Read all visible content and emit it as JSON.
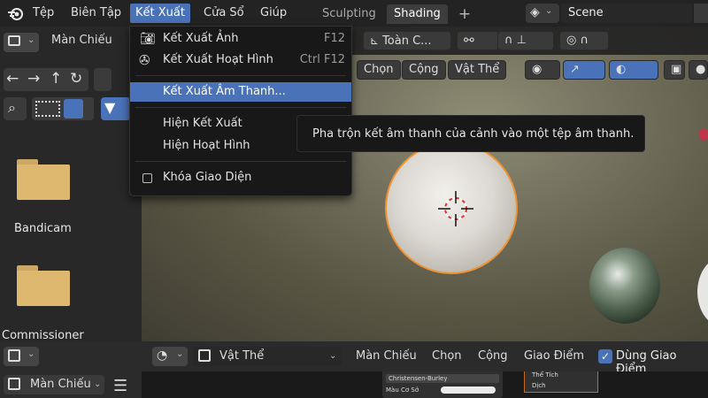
{
  "topbar": {
    "menus": [
      "Tệp",
      "Biên Tập",
      "Kết Xuất",
      "Cửa Sổ",
      "Giúp"
    ],
    "workspace_tabs": [
      "Sculpting",
      "Shading"
    ],
    "add_tab": "+",
    "scene_name": "Scene"
  },
  "file_browser": {
    "view_label": "Màn Chiếu",
    "folders": [
      "Bandicam",
      "Commissioner"
    ]
  },
  "viewport": {
    "transform_orientation": "Toàn C...",
    "header_buttons": [
      "Chọn",
      "Cộng",
      "Vật Thể"
    ]
  },
  "render_menu": {
    "items": [
      {
        "label": "Kết Xuất Ảnh",
        "shortcut": "F12",
        "icon": "camera-icon"
      },
      {
        "label": "Kết Xuất Hoạt Hình",
        "shortcut": "Ctrl F12",
        "icon": "film-reel-icon"
      },
      {
        "label": "Kết Xuất Âm Thanh...",
        "shortcut": "",
        "highlighted": true
      },
      {
        "label": "Hiện Kết Xuất",
        "shortcut": ""
      },
      {
        "label": "Hiện Hoạt Hình",
        "shortcut": ""
      },
      {
        "label": "Khóa Giao Diện",
        "shortcut": "",
        "checkbox": false
      }
    ]
  },
  "tooltip": "Pha trộn kết âm thanh của cảnh vào một tệp âm thanh.",
  "bottom_bar": {
    "mode": "Vật Thể",
    "menus": [
      "Màn Chiếu",
      "Chọn",
      "Cộng",
      "Giao Điểm"
    ],
    "use_nodes_label": "Dùng Giao Điểm",
    "use_nodes_checked": true,
    "left_view_label": "Màn Chiếu"
  },
  "node_editor": {
    "bsdf_method": "Christensen-Burley",
    "base_color_label": "Màu Cơ Sở",
    "outputs": [
      "Thể Tích",
      "Dịch"
    ]
  },
  "colors": {
    "accent": "#4a72b8",
    "selection_outline": "#f0922f"
  }
}
